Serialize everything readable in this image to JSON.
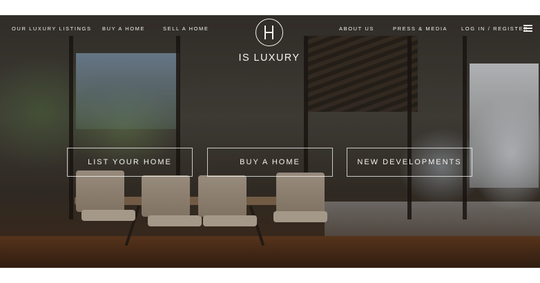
{
  "header": {
    "nav_left": [
      "OUR LUXURY LISTINGS",
      "BUY A HOME",
      "SELL A HOME"
    ],
    "nav_right": [
      "ABOUT US",
      "PRESS & MEDIA",
      "LOG IN / REGISTER"
    ],
    "logo_text": "IS LUXURY",
    "menu_icon": "hamburger-menu-icon"
  },
  "hero": {
    "ctas": [
      "LIST YOUR HOME",
      "BUY A HOME",
      "NEW DEVELOPMENTS"
    ]
  },
  "colors": {
    "text": "#f2f0ec",
    "outline": "#ffffff",
    "floor": "#6a3f22"
  }
}
